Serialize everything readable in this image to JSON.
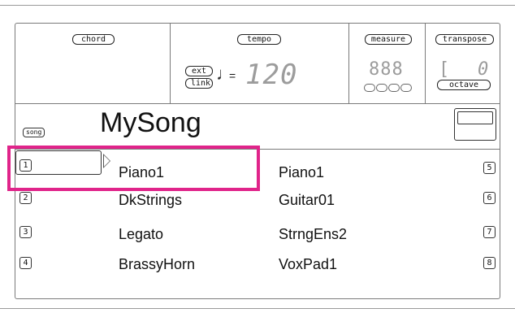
{
  "labels": {
    "chord": "chord",
    "tempo": "tempo",
    "measure": "measure",
    "transpose": "transpose",
    "ext": "ext",
    "link": "link",
    "equals": "=",
    "tempo_value": "120",
    "measure_value": "888",
    "transpose_prefix": "[",
    "transpose_value": "0",
    "octave": "octave",
    "song": "song"
  },
  "song_name": "MySong",
  "tracks": [
    {
      "num": "1",
      "left": "Piano1",
      "right": "Piano1",
      "num_r": "5"
    },
    {
      "num": "2",
      "left": "DkStrings",
      "right": "Guitar01",
      "num_r": "6"
    },
    {
      "num": "3",
      "left": "Legato",
      "right": "StrngEns2",
      "num_r": "7"
    },
    {
      "num": "4",
      "left": "BrassyHorn",
      "right": "VoxPad1",
      "num_r": "8"
    }
  ],
  "colors": {
    "highlight": "#e0248a",
    "lcd_digits": "#9c9c9c"
  }
}
